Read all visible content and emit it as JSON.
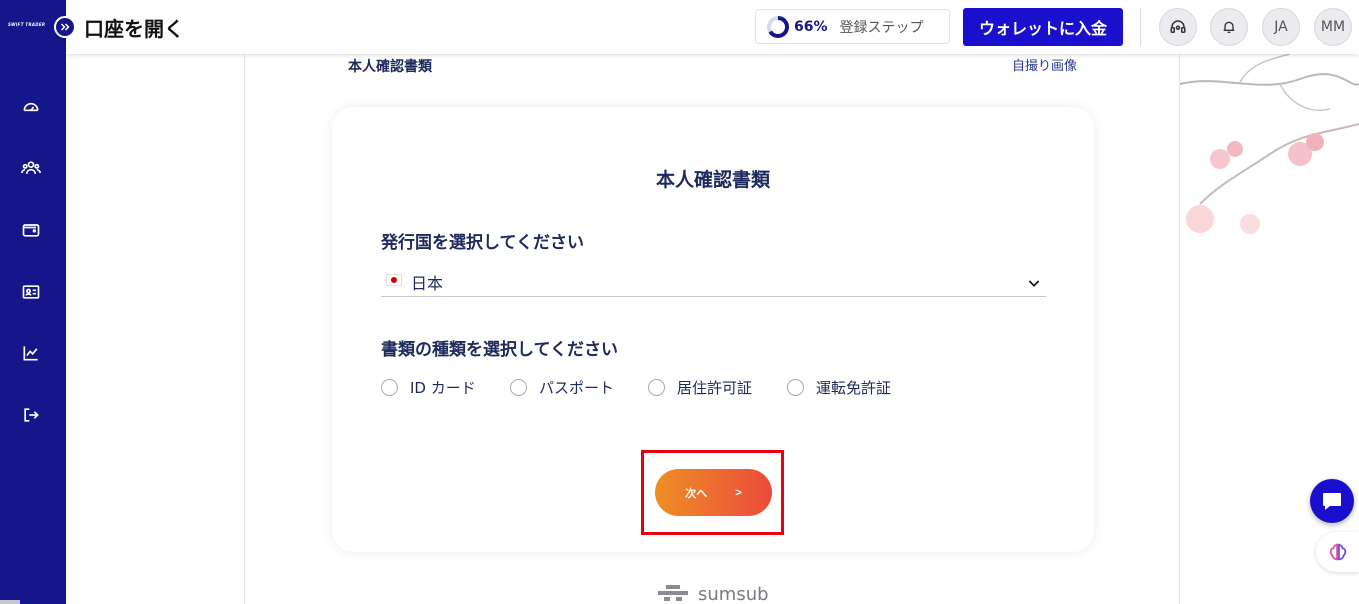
{
  "sidebar": {
    "logo": "SWIFT TRADER",
    "items": [
      {
        "icon": "dashboard-icon"
      },
      {
        "icon": "users-icon"
      },
      {
        "icon": "wallet-icon"
      },
      {
        "icon": "id-card-icon"
      },
      {
        "icon": "chart-icon"
      },
      {
        "icon": "logout-icon"
      }
    ]
  },
  "header": {
    "title": "口座を開く",
    "progress": {
      "percent": 66,
      "percent_label": "66%",
      "label": "登録ステップ"
    },
    "deposit_label": "ウォレットに入金",
    "lang": "JA",
    "user_initials": "MM"
  },
  "breadcrumb": {
    "left": "本人確認書類",
    "right": "自撮り画像"
  },
  "card": {
    "title": "本人確認書類",
    "country_label": "発行国を選択してください",
    "country_value": "日本",
    "doc_type_label": "書類の種類を選択してください",
    "doc_types": [
      "ID カード",
      "パスポート",
      "居住許可証",
      "運転免許証"
    ],
    "next_label": "次へ",
    "next_arrow": ">"
  },
  "footer": {
    "brand": "sumsub"
  },
  "colors": {
    "sidebar": "#16168a",
    "primary": "#1a0fcc",
    "text": "#1f2a5c",
    "button_gradient_start": "#ee8f25",
    "button_gradient_end": "#ec4a3c",
    "highlight": "#e8000f"
  }
}
